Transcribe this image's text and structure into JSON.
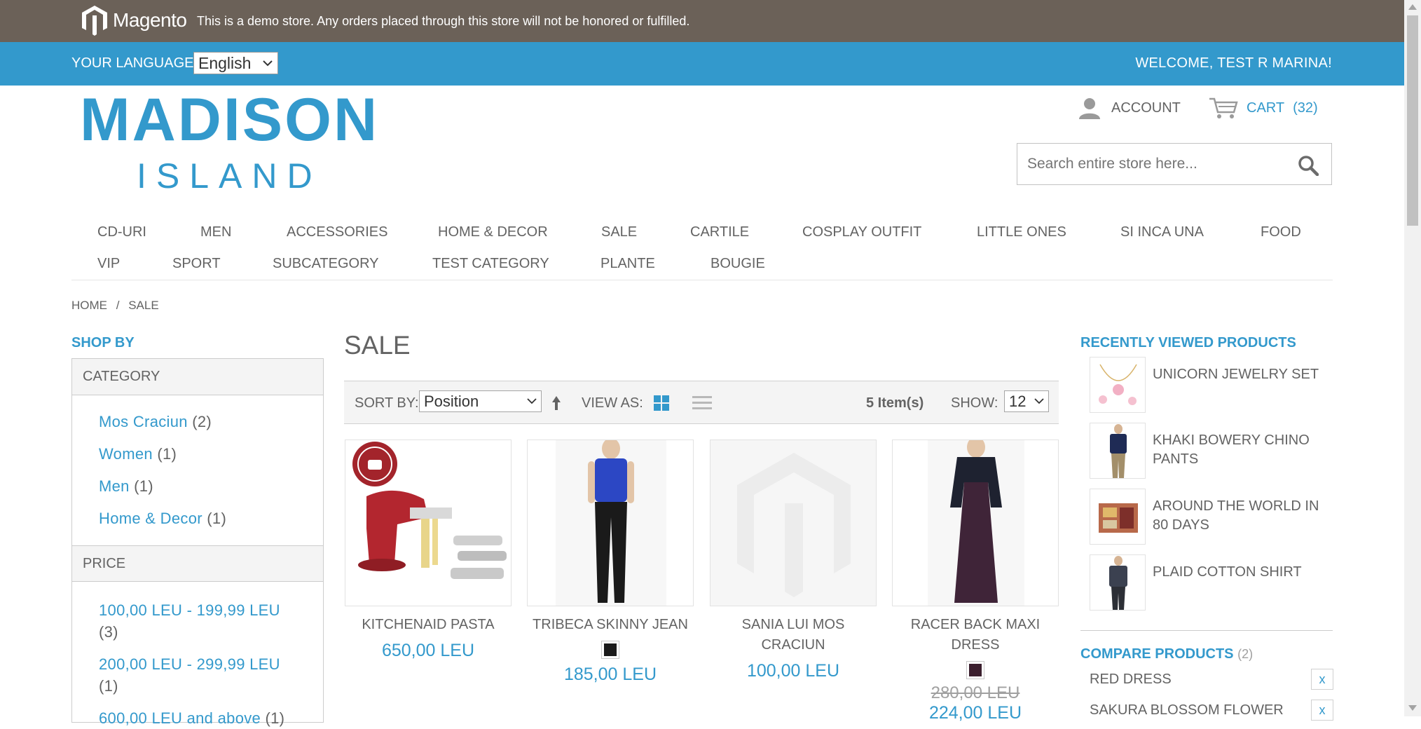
{
  "demo_notice": {
    "brand": "Magento",
    "text": "This is a demo store. Any orders placed through this store will not be honored or fulfilled."
  },
  "language": {
    "label": "YOUR LANGUAGE:",
    "selected": "English"
  },
  "welcome": "WELCOME, TEST R MARINA!",
  "logo": {
    "line1": "MADISON",
    "line2": "ISLAND"
  },
  "header": {
    "account_label": "ACCOUNT",
    "cart_label": "CART",
    "cart_count": "(32)",
    "search_placeholder": "Search entire store here..."
  },
  "nav": {
    "row1": [
      "CD-URI",
      "MEN",
      "ACCESSORIES",
      "HOME & DECOR",
      "SALE",
      "CARTILE",
      "COSPLAY OUTFIT",
      "LITTLE ONES",
      "SI INCA UNA",
      "FOOD"
    ],
    "row2": [
      "VIP",
      "SPORT",
      "SUBCATEGORY",
      "TEST CATEGORY",
      "PLANTE",
      "BOUGIE"
    ]
  },
  "breadcrumb": {
    "home": "HOME",
    "sep": "/",
    "current": "SALE"
  },
  "sidebar": {
    "title": "SHOP BY",
    "category_head": "CATEGORY",
    "categories": [
      {
        "label": "Mos Craciun",
        "count": "(2)"
      },
      {
        "label": "Women",
        "count": "(1)"
      },
      {
        "label": "Men",
        "count": "(1)"
      },
      {
        "label": "Home & Decor",
        "count": "(1)"
      }
    ],
    "price_head": "PRICE",
    "prices": [
      {
        "label": "100,00 LEU - 199,99 LEU",
        "count": "(3)"
      },
      {
        "label": "200,00 LEU - 299,99 LEU",
        "count": "(1)"
      },
      {
        "label": "600,00 LEU and above",
        "count": "(1)"
      }
    ]
  },
  "page_title": "SALE",
  "toolbar": {
    "sort_label": "SORT BY:",
    "sort_value": "Position",
    "view_label": "VIEW AS:",
    "items_count": "5 Item(s)",
    "show_label": "SHOW:",
    "show_value": "12"
  },
  "products": [
    {
      "name": "KITCHENAID PASTA",
      "price": "650,00 LEU"
    },
    {
      "name": "TRIBECA SKINNY JEAN",
      "price": "185,00 LEU",
      "swatch": "#1a1a1a"
    },
    {
      "name": "SANIA LUI MOS CRACIUN",
      "price": "100,00 LEU"
    },
    {
      "name": "RACER BACK MAXI DRESS",
      "old_price": "280,00 LEU",
      "price": "224,00 LEU",
      "swatch": "#3b1f2e"
    }
  ],
  "recently_viewed": {
    "title": "RECENTLY VIEWED PRODUCTS",
    "items": [
      "UNICORN JEWELRY SET",
      "KHAKI BOWERY CHINO PANTS",
      "AROUND THE WORLD IN 80 DAYS",
      "PLAID COTTON SHIRT"
    ]
  },
  "compare": {
    "title": "COMPARE PRODUCTS",
    "count": "(2)",
    "items": [
      "RED DRESS",
      "SAKURA BLOSSOM FLOWER"
    ],
    "remove_label": "x"
  },
  "colors": {
    "accent": "#3399cc",
    "demo_bar": "#6b6158",
    "text": "#636363"
  }
}
